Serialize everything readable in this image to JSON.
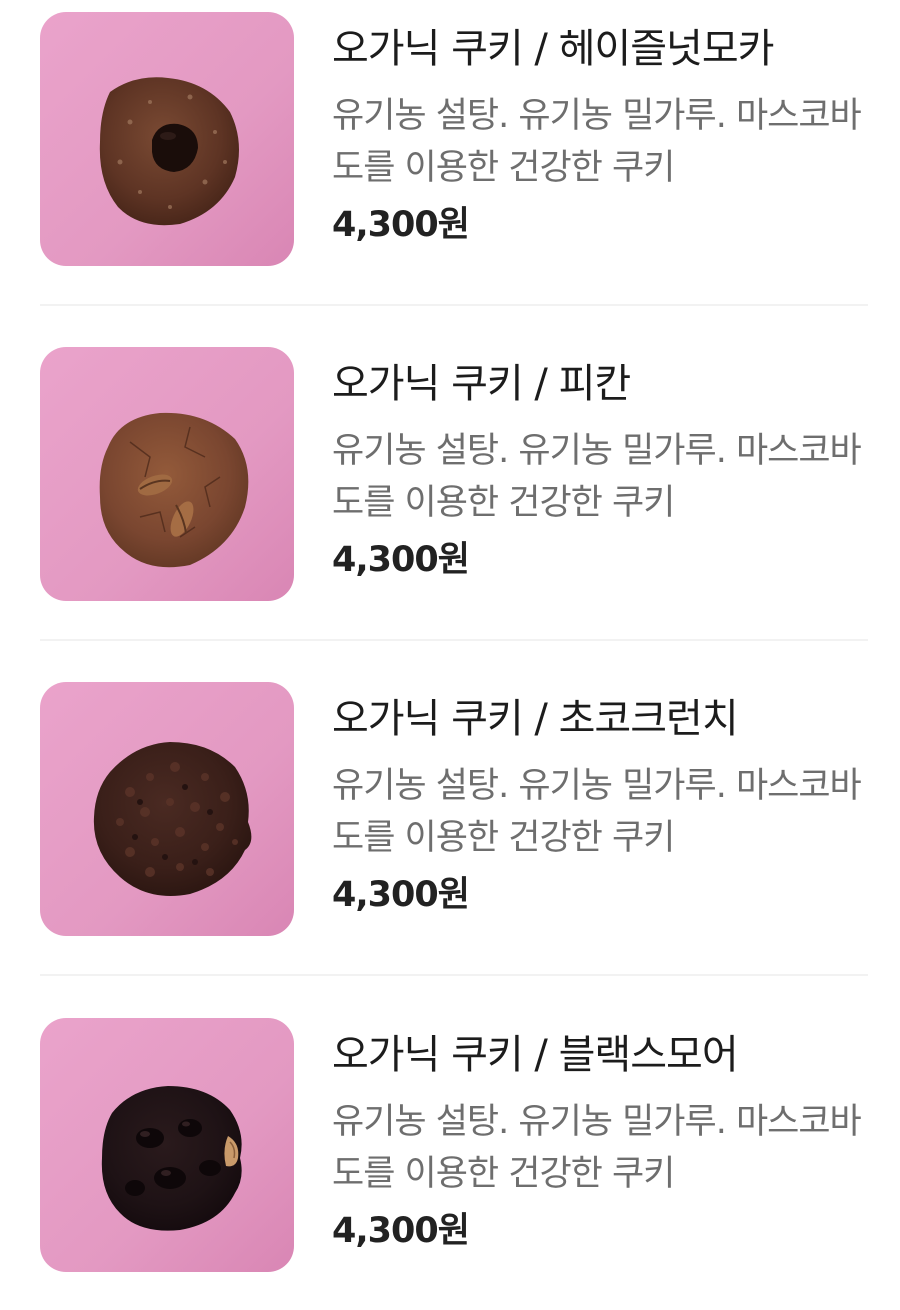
{
  "menu": {
    "items": [
      {
        "title": "오가닉 쿠키 / 헤이즐넛모카",
        "description": "유기농 설탕. 유기농 밀가루. 마스코바도를 이용한 건강한 쿠키",
        "price": "4,300원",
        "image": "hazelnut-mocha-cookie-photo"
      },
      {
        "title": "오가닉 쿠키 / 피칸",
        "description": "유기농 설탕. 유기농 밀가루. 마스코바도를 이용한 건강한 쿠키",
        "price": "4,300원",
        "image": "pecan-cookie-photo"
      },
      {
        "title": "오가닉 쿠키 / 초코크런치",
        "description": "유기농 설탕. 유기농 밀가루. 마스코바도를 이용한 건강한 쿠키",
        "price": "4,300원",
        "image": "choco-crunch-cookie-photo"
      },
      {
        "title": "오가닉 쿠키 / 블랙스모어",
        "description": "유기농 설탕. 유기농 밀가루. 마스코바도를 이용한 건강한 쿠키",
        "price": "4,300원",
        "image": "black-smore-cookie-photo"
      }
    ]
  },
  "colors": {
    "thumb_background": "#e59ac4",
    "divider": "#f2f2f2",
    "title": "#1c1c1c",
    "description": "#6e6e6e",
    "price": "#222222"
  }
}
